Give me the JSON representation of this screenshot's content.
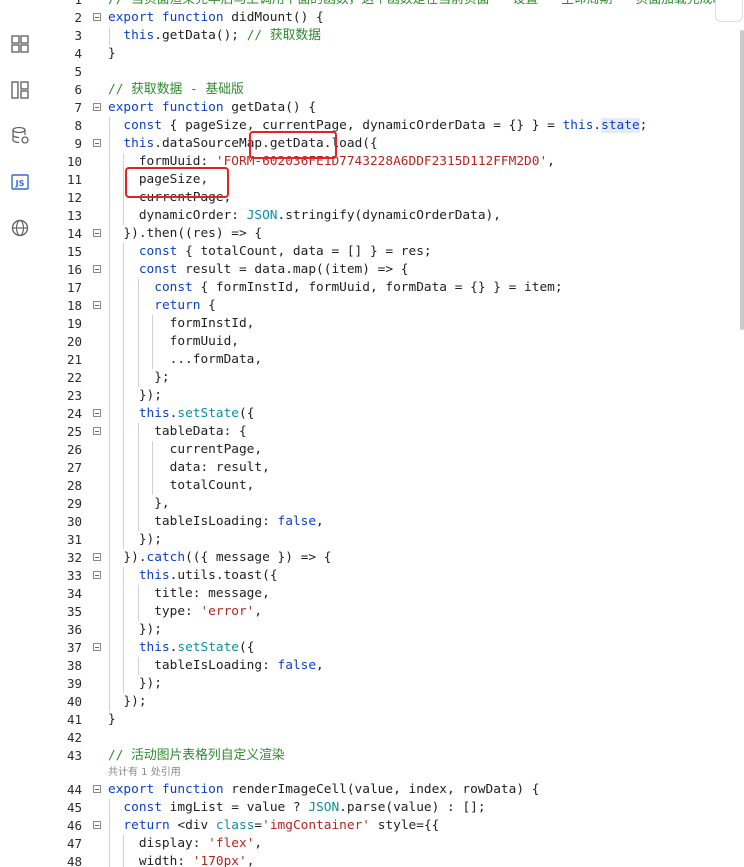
{
  "activity_bar": {
    "items": [
      {
        "name": "menu-icon"
      },
      {
        "name": "components-grid-icon"
      },
      {
        "name": "page-layout-icon"
      },
      {
        "name": "data-source-icon"
      },
      {
        "name": "js-icon",
        "label": "JS"
      },
      {
        "name": "globe-icon"
      }
    ]
  },
  "editor": {
    "lines": [
      {
        "n": "1",
        "fold": false,
        "guides": 0,
        "tokens": [
          [
            "// 当页面渲染完毕后马上调用下面的函数，这个函数是在当前页面 - 设置 - 生命周期 - 页面加载完成时中被关联",
            "c"
          ]
        ]
      },
      {
        "n": "2",
        "fold": true,
        "guides": 0,
        "tokens": [
          [
            "export function",
            "k"
          ],
          [
            " didMount() {",
            ""
          ]
        ]
      },
      {
        "n": "3",
        "fold": false,
        "guides": 1,
        "tokens": [
          [
            "  ",
            ""
          ],
          [
            "this",
            "k"
          ],
          [
            ".getData(); ",
            ""
          ],
          [
            "// 获取数据",
            "c"
          ]
        ]
      },
      {
        "n": "4",
        "fold": false,
        "guides": 0,
        "tokens": [
          [
            "}",
            ""
          ]
        ]
      },
      {
        "n": "5",
        "fold": false,
        "guides": 0,
        "tokens": []
      },
      {
        "n": "6",
        "fold": false,
        "guides": 0,
        "tokens": [
          [
            "// 获取数据 - 基础版",
            "c"
          ]
        ]
      },
      {
        "n": "7",
        "fold": true,
        "guides": 0,
        "tokens": [
          [
            "export function",
            "k"
          ],
          [
            " getData() {",
            ""
          ]
        ]
      },
      {
        "n": "8",
        "fold": false,
        "guides": 1,
        "tokens": [
          [
            "  ",
            ""
          ],
          [
            "const",
            "k"
          ],
          [
            " { pageSize, currentPage, dynamicOrderData = {} } = ",
            ""
          ],
          [
            "this",
            "k"
          ],
          [
            ".",
            ""
          ],
          [
            "state",
            "state"
          ],
          [
            ";",
            ""
          ]
        ]
      },
      {
        "n": "9",
        "fold": true,
        "guides": 1,
        "tokens": [
          [
            "  ",
            ""
          ],
          [
            "this",
            "k"
          ],
          [
            ".dataSourceMap.getData.load({",
            ""
          ]
        ]
      },
      {
        "n": "10",
        "fold": false,
        "guides": 2,
        "tokens": [
          [
            "    formUuid: ",
            ""
          ],
          [
            "'FORM-602036FE1D7743228A6DDF2315D112FFM2D0'",
            "s"
          ],
          [
            ",",
            ""
          ]
        ]
      },
      {
        "n": "11",
        "fold": false,
        "guides": 2,
        "tokens": [
          [
            "    pageSize,",
            ""
          ]
        ]
      },
      {
        "n": "12",
        "fold": false,
        "guides": 2,
        "tokens": [
          [
            "    currentPage,",
            ""
          ]
        ]
      },
      {
        "n": "13",
        "fold": false,
        "guides": 2,
        "tokens": [
          [
            "    dynamicOrder: ",
            ""
          ],
          [
            "JSON",
            "t"
          ],
          [
            ".stringify(dynamicOrderData),",
            ""
          ]
        ]
      },
      {
        "n": "14",
        "fold": true,
        "guides": 1,
        "tokens": [
          [
            "  }).then((res) => {",
            ""
          ]
        ]
      },
      {
        "n": "15",
        "fold": false,
        "guides": 2,
        "tokens": [
          [
            "    ",
            ""
          ],
          [
            "const",
            "k"
          ],
          [
            " { totalCount, data = [] } = res;",
            ""
          ]
        ]
      },
      {
        "n": "16",
        "fold": true,
        "guides": 2,
        "tokens": [
          [
            "    ",
            ""
          ],
          [
            "const",
            "k"
          ],
          [
            " result = data.map((item) => {",
            ""
          ]
        ]
      },
      {
        "n": "17",
        "fold": false,
        "guides": 3,
        "tokens": [
          [
            "      ",
            ""
          ],
          [
            "const",
            "k"
          ],
          [
            " { formInstId, formUuid, formData = {} } = item;",
            ""
          ]
        ]
      },
      {
        "n": "18",
        "fold": true,
        "guides": 3,
        "tokens": [
          [
            "      ",
            ""
          ],
          [
            "return",
            "k"
          ],
          [
            " {",
            ""
          ]
        ]
      },
      {
        "n": "19",
        "fold": false,
        "guides": 4,
        "tokens": [
          [
            "        formInstId,",
            ""
          ]
        ]
      },
      {
        "n": "20",
        "fold": false,
        "guides": 4,
        "tokens": [
          [
            "        formUuid,",
            ""
          ]
        ]
      },
      {
        "n": "21",
        "fold": false,
        "guides": 4,
        "tokens": [
          [
            "        ...formData,",
            ""
          ]
        ]
      },
      {
        "n": "22",
        "fold": false,
        "guides": 3,
        "tokens": [
          [
            "      };",
            ""
          ]
        ]
      },
      {
        "n": "23",
        "fold": false,
        "guides": 2,
        "tokens": [
          [
            "    });",
            ""
          ]
        ]
      },
      {
        "n": "24",
        "fold": true,
        "guides": 2,
        "tokens": [
          [
            "    ",
            ""
          ],
          [
            "this",
            "k"
          ],
          [
            ".",
            ""
          ],
          [
            "setState",
            "t"
          ],
          [
            "({",
            ""
          ]
        ]
      },
      {
        "n": "25",
        "fold": true,
        "guides": 3,
        "tokens": [
          [
            "      tableData: {",
            ""
          ]
        ]
      },
      {
        "n": "26",
        "fold": false,
        "guides": 4,
        "tokens": [
          [
            "        currentPage,",
            ""
          ]
        ]
      },
      {
        "n": "27",
        "fold": false,
        "guides": 4,
        "tokens": [
          [
            "        data: result,",
            ""
          ]
        ]
      },
      {
        "n": "28",
        "fold": false,
        "guides": 4,
        "tokens": [
          [
            "        totalCount,",
            ""
          ]
        ]
      },
      {
        "n": "29",
        "fold": false,
        "guides": 3,
        "tokens": [
          [
            "      },",
            ""
          ]
        ]
      },
      {
        "n": "30",
        "fold": false,
        "guides": 3,
        "tokens": [
          [
            "      tableIsLoading: ",
            ""
          ],
          [
            "false",
            "k"
          ],
          [
            ",",
            ""
          ]
        ]
      },
      {
        "n": "31",
        "fold": false,
        "guides": 2,
        "tokens": [
          [
            "    });",
            ""
          ]
        ]
      },
      {
        "n": "32",
        "fold": true,
        "guides": 1,
        "tokens": [
          [
            "  }).",
            ""
          ],
          [
            "catch",
            "k"
          ],
          [
            "(({ message }) => {",
            ""
          ]
        ]
      },
      {
        "n": "33",
        "fold": true,
        "guides": 2,
        "tokens": [
          [
            "    ",
            ""
          ],
          [
            "this",
            "k"
          ],
          [
            ".utils.toast({",
            ""
          ]
        ]
      },
      {
        "n": "34",
        "fold": false,
        "guides": 3,
        "tokens": [
          [
            "      title: message,",
            ""
          ]
        ]
      },
      {
        "n": "35",
        "fold": false,
        "guides": 3,
        "tokens": [
          [
            "      type: ",
            ""
          ],
          [
            "'error'",
            "s"
          ],
          [
            ",",
            ""
          ]
        ]
      },
      {
        "n": "36",
        "fold": false,
        "guides": 2,
        "tokens": [
          [
            "    });",
            ""
          ]
        ]
      },
      {
        "n": "37",
        "fold": true,
        "guides": 2,
        "tokens": [
          [
            "    ",
            ""
          ],
          [
            "this",
            "k"
          ],
          [
            ".",
            ""
          ],
          [
            "setState",
            "t"
          ],
          [
            "({",
            ""
          ]
        ]
      },
      {
        "n": "38",
        "fold": false,
        "guides": 3,
        "tokens": [
          [
            "      tableIsLoading: ",
            ""
          ],
          [
            "false",
            "k"
          ],
          [
            ",",
            ""
          ]
        ]
      },
      {
        "n": "39",
        "fold": false,
        "guides": 2,
        "tokens": [
          [
            "    });",
            ""
          ]
        ]
      },
      {
        "n": "40",
        "fold": false,
        "guides": 1,
        "tokens": [
          [
            "  });",
            ""
          ]
        ]
      },
      {
        "n": "41",
        "fold": false,
        "guides": 0,
        "tokens": [
          [
            "}",
            ""
          ]
        ]
      },
      {
        "n": "42",
        "fold": false,
        "guides": 0,
        "tokens": []
      },
      {
        "n": "43",
        "fold": false,
        "guides": 0,
        "tokens": [
          [
            "// 活动图片表格列自定义渲染",
            "c"
          ]
        ]
      },
      {
        "codelens": "共计有 1 处引用"
      },
      {
        "n": "44",
        "fold": true,
        "guides": 0,
        "tokens": [
          [
            "export function",
            "k"
          ],
          [
            " renderImageCell(value, index, rowData) {",
            ""
          ]
        ]
      },
      {
        "n": "45",
        "fold": false,
        "guides": 1,
        "tokens": [
          [
            "  ",
            ""
          ],
          [
            "const",
            "k"
          ],
          [
            " imgList = value ? ",
            ""
          ],
          [
            "JSON",
            "t"
          ],
          [
            ".parse(value) : [];",
            ""
          ]
        ]
      },
      {
        "n": "46",
        "fold": true,
        "guides": 1,
        "tokens": [
          [
            "  ",
            ""
          ],
          [
            "return",
            "k"
          ],
          [
            " <div ",
            ""
          ],
          [
            "class",
            "t"
          ],
          [
            "=",
            ""
          ],
          [
            "'imgContainer'",
            "s"
          ],
          [
            " style={{",
            ""
          ]
        ]
      },
      {
        "n": "47",
        "fold": false,
        "guides": 2,
        "tokens": [
          [
            "    display: ",
            ""
          ],
          [
            "'flex'",
            "s"
          ],
          [
            ",",
            ""
          ]
        ]
      },
      {
        "n": "48",
        "fold": false,
        "guides": 2,
        "tokens": [
          [
            "    width: ",
            ""
          ],
          [
            "'170px'",
            "s"
          ],
          [
            ",",
            ""
          ]
        ]
      }
    ]
  }
}
